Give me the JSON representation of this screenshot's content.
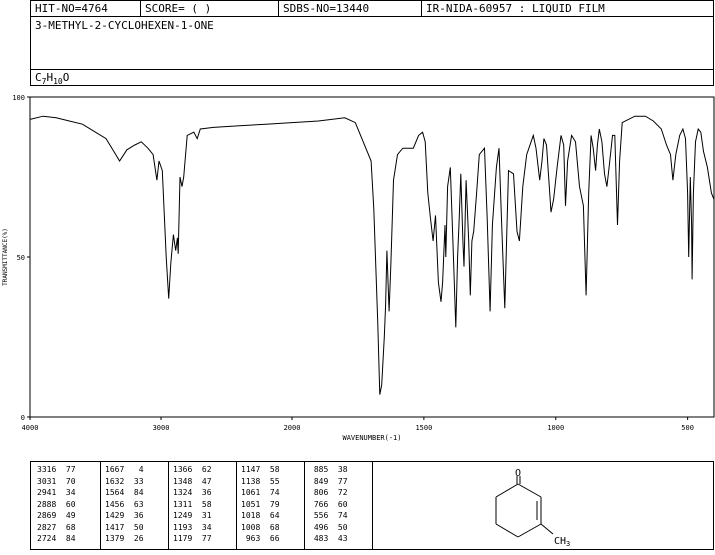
{
  "header": {
    "hit_no": "HIT-NO=4764",
    "score": "SCORE=  (   )",
    "sdbs_no": "SDBS-NO=13440",
    "source": "IR-NIDA-60957 : LIQUID FILM",
    "compound_name": "3-METHYL-2-CYCLOHEXEN-1-ONE",
    "formula": "C7H10O"
  },
  "chart_data": {
    "type": "line",
    "xlabel": "WAVENUMBER(-1)",
    "ylabel": "TRANSMITTANCE(%)",
    "xlim": [
      4000,
      400
    ],
    "ylim": [
      0,
      100
    ],
    "xticks": [
      4000,
      3000,
      2000,
      1500,
      1000,
      500
    ],
    "yticks": [
      0,
      50,
      100
    ],
    "grid": false,
    "series": [
      {
        "points": [
          [
            4000,
            93
          ],
          [
            3900,
            94
          ],
          [
            3800,
            93.5
          ],
          [
            3700,
            92.5
          ],
          [
            3600,
            91.5
          ],
          [
            3500,
            89
          ],
          [
            3420,
            87
          ],
          [
            3360,
            83
          ],
          [
            3316,
            80
          ],
          [
            3260,
            83.5
          ],
          [
            3200,
            85
          ],
          [
            3150,
            86
          ],
          [
            3100,
            84
          ],
          [
            3060,
            82
          ],
          [
            3031,
            74
          ],
          [
            3015,
            80
          ],
          [
            2990,
            77
          ],
          [
            2960,
            50
          ],
          [
            2941,
            37
          ],
          [
            2925,
            48
          ],
          [
            2905,
            57
          ],
          [
            2888,
            52
          ],
          [
            2875,
            56
          ],
          [
            2869,
            51
          ],
          [
            2855,
            75
          ],
          [
            2840,
            72
          ],
          [
            2827,
            75
          ],
          [
            2800,
            88
          ],
          [
            2750,
            89
          ],
          [
            2724,
            87
          ],
          [
            2700,
            90
          ],
          [
            2600,
            90.5
          ],
          [
            2400,
            91
          ],
          [
            2200,
            91.5
          ],
          [
            2000,
            92
          ],
          [
            1900,
            92.5
          ],
          [
            1800,
            93.5
          ],
          [
            1760,
            92
          ],
          [
            1730,
            86
          ],
          [
            1700,
            80
          ],
          [
            1690,
            65
          ],
          [
            1675,
            30
          ],
          [
            1667,
            7
          ],
          [
            1660,
            10
          ],
          [
            1650,
            25
          ],
          [
            1645,
            35
          ],
          [
            1640,
            52
          ],
          [
            1632,
            33
          ],
          [
            1625,
            48
          ],
          [
            1615,
            74
          ],
          [
            1600,
            82
          ],
          [
            1580,
            84
          ],
          [
            1564,
            84
          ],
          [
            1540,
            84
          ],
          [
            1520,
            88
          ],
          [
            1505,
            89
          ],
          [
            1495,
            86
          ],
          [
            1485,
            70
          ],
          [
            1475,
            62
          ],
          [
            1465,
            55
          ],
          [
            1456,
            63
          ],
          [
            1445,
            42
          ],
          [
            1435,
            36
          ],
          [
            1429,
            42
          ],
          [
            1420,
            60
          ],
          [
            1417,
            50
          ],
          [
            1410,
            72
          ],
          [
            1400,
            78
          ],
          [
            1390,
            55
          ],
          [
            1379,
            28
          ],
          [
            1372,
            50
          ],
          [
            1366,
            62
          ],
          [
            1360,
            76
          ],
          [
            1352,
            55
          ],
          [
            1348,
            47
          ],
          [
            1340,
            74
          ],
          [
            1330,
            55
          ],
          [
            1324,
            38
          ],
          [
            1318,
            55
          ],
          [
            1311,
            58
          ],
          [
            1300,
            70
          ],
          [
            1290,
            82
          ],
          [
            1270,
            84
          ],
          [
            1260,
            62
          ],
          [
            1249,
            33
          ],
          [
            1240,
            60
          ],
          [
            1225,
            78
          ],
          [
            1215,
            84
          ],
          [
            1205,
            60
          ],
          [
            1193,
            34
          ],
          [
            1185,
            60
          ],
          [
            1179,
            77
          ],
          [
            1160,
            76
          ],
          [
            1147,
            58
          ],
          [
            1138,
            55
          ],
          [
            1125,
            72
          ],
          [
            1110,
            82
          ],
          [
            1085,
            88
          ],
          [
            1075,
            84
          ],
          [
            1061,
            74
          ],
          [
            1052,
            80
          ],
          [
            1045,
            87
          ],
          [
            1035,
            85
          ],
          [
            1018,
            64
          ],
          [
            1008,
            68
          ],
          [
            995,
            78
          ],
          [
            980,
            88
          ],
          [
            970,
            85
          ],
          [
            963,
            66
          ],
          [
            955,
            80
          ],
          [
            940,
            88
          ],
          [
            925,
            86
          ],
          [
            910,
            72
          ],
          [
            895,
            66
          ],
          [
            885,
            38
          ],
          [
            875,
            70
          ],
          [
            866,
            88
          ],
          [
            858,
            84
          ],
          [
            849,
            77
          ],
          [
            842,
            85
          ],
          [
            835,
            90
          ],
          [
            825,
            86
          ],
          [
            815,
            76
          ],
          [
            806,
            72
          ],
          [
            795,
            80
          ],
          [
            785,
            88
          ],
          [
            776,
            88
          ],
          [
            766,
            60
          ],
          [
            758,
            80
          ],
          [
            748,
            92
          ],
          [
            700,
            94
          ],
          [
            660,
            94
          ],
          [
            630,
            92.5
          ],
          [
            600,
            90
          ],
          [
            580,
            85
          ],
          [
            565,
            82
          ],
          [
            556,
            74
          ],
          [
            545,
            82
          ],
          [
            530,
            88
          ],
          [
            518,
            90
          ],
          [
            508,
            87
          ],
          [
            500,
            70
          ],
          [
            496,
            50
          ],
          [
            490,
            75
          ],
          [
            485,
            60
          ],
          [
            483,
            43
          ],
          [
            478,
            70
          ],
          [
            470,
            86
          ],
          [
            460,
            90
          ],
          [
            450,
            89
          ],
          [
            440,
            83
          ],
          [
            425,
            78
          ],
          [
            410,
            70
          ],
          [
            400,
            68
          ]
        ]
      }
    ],
    "peak_table_columns": [
      [
        "3316",
        "77",
        "3031",
        "70",
        "2941",
        "34",
        "2888",
        "60",
        "2869",
        "49",
        "2827",
        "68",
        "2724",
        "84"
      ],
      [
        "1667",
        "4",
        "1632",
        "33",
        "1564",
        "84",
        "1456",
        "63",
        "1429",
        "36",
        "1417",
        "50",
        "1379",
        "26"
      ],
      [
        "1366",
        "62",
        "1348",
        "47",
        "1324",
        "36",
        "1311",
        "58",
        "1249",
        "31",
        "1193",
        "34",
        "1179",
        "77"
      ],
      [
        "1147",
        "58",
        "1138",
        "55",
        "1061",
        "74",
        "1051",
        "79",
        "1018",
        "64",
        "1008",
        "68",
        "963",
        "66"
      ],
      [
        "885",
        "38",
        "849",
        "77",
        "806",
        "72",
        "766",
        "60",
        "556",
        "74",
        "496",
        "50",
        "483",
        "43"
      ]
    ]
  },
  "structure": {
    "oxygen_label": "O",
    "methyl_label": "CH3"
  }
}
